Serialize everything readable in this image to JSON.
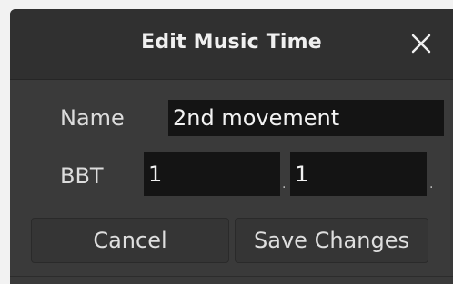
{
  "dialog": {
    "title": "Edit Music Time",
    "close_icon": "close-icon"
  },
  "form": {
    "name_label": "Name",
    "name_value": "2nd movement",
    "bbt_label": "BBT",
    "bbt_bars": "1",
    "bbt_beats": "1",
    "bbt_separator": "."
  },
  "buttons": {
    "cancel_label": "Cancel",
    "save_label": "Save Changes"
  },
  "colors": {
    "dialog_bg": "#3a3a3a",
    "titlebar_bg": "#303030",
    "field_bg": "#141414",
    "text": "#dcdcdc"
  }
}
